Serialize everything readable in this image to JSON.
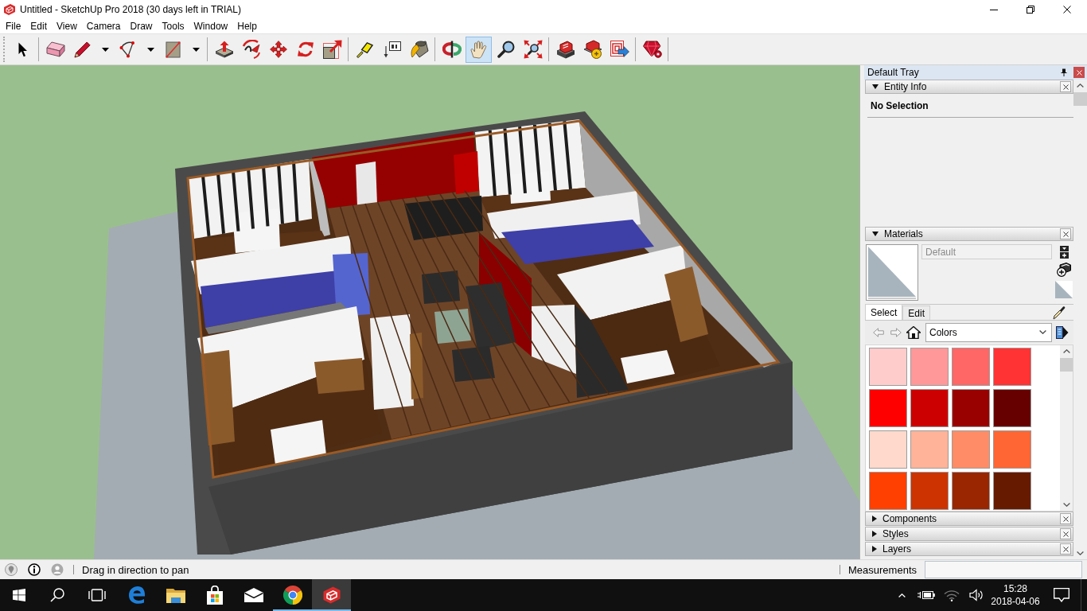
{
  "window": {
    "title": "Untitled - SketchUp Pro 2018 (30 days left in TRIAL)"
  },
  "menu": [
    "File",
    "Edit",
    "View",
    "Camera",
    "Draw",
    "Tools",
    "Window",
    "Help"
  ],
  "toolbar": {
    "groups": [
      {
        "tools": [
          {
            "selected": false,
            "dropdown": false
          }
        ]
      },
      {
        "tools": [
          {
            "selected": false,
            "dropdown": false
          },
          {
            "selected": false,
            "dropdown": true
          },
          {
            "selected": false,
            "dropdown": true
          },
          {
            "selected": false,
            "dropdown": true
          }
        ]
      },
      {
        "tools": [
          {
            "selected": false,
            "dropdown": false
          },
          {
            "selected": false,
            "dropdown": false
          },
          {
            "selected": false,
            "dropdown": false
          },
          {
            "selected": false,
            "dropdown": false
          },
          {
            "selected": false,
            "dropdown": false
          }
        ]
      },
      {
        "tools": [
          {
            "selected": false,
            "dropdown": false
          },
          {
            "selected": false,
            "dropdown": false
          },
          {
            "selected": false,
            "dropdown": false
          }
        ]
      },
      {
        "tools": [
          {
            "selected": false,
            "dropdown": false
          },
          {
            "selected": true,
            "dropdown": false
          },
          {
            "selected": false,
            "dropdown": false
          },
          {
            "selected": false,
            "dropdown": false
          }
        ]
      },
      {
        "tools": [
          {
            "selected": false,
            "dropdown": false
          },
          {
            "selected": false,
            "dropdown": false
          },
          {
            "selected": false,
            "dropdown": false
          }
        ]
      },
      {
        "tools": [
          {
            "selected": false,
            "dropdown": false
          }
        ]
      }
    ]
  },
  "tray": {
    "title": "Default Tray",
    "panels": [
      {
        "kind": "entity_info",
        "title": "Entity Info",
        "expanded": true,
        "text": "No Selection"
      },
      {
        "kind": "materials",
        "title": "Materials",
        "expanded": true,
        "name_field": {
          "value": "Default",
          "disabled": true
        },
        "tabs": [
          {
            "label": "Select",
            "selected": true
          },
          {
            "label": "Edit",
            "selected": false
          }
        ],
        "library": "Colors",
        "swatches": [
          {
            "color": "#ffcccc"
          },
          {
            "color": "#ff9999"
          },
          {
            "color": "#ff6666"
          },
          {
            "color": "#ff3333"
          },
          {
            "color": "#ff0000"
          },
          {
            "color": "#cc0000"
          },
          {
            "color": "#990000"
          },
          {
            "color": "#660000"
          },
          {
            "color": "#ffd9cc"
          },
          {
            "color": "#ffb399"
          },
          {
            "color": "#ff8c66"
          },
          {
            "color": "#ff6633"
          },
          {
            "color": "#ff4000"
          },
          {
            "color": "#cc3300"
          },
          {
            "color": "#992600"
          },
          {
            "color": "#661a00"
          }
        ]
      },
      {
        "kind": "panel",
        "title": "Components",
        "expanded": false
      },
      {
        "kind": "panel",
        "title": "Styles",
        "expanded": false
      },
      {
        "kind": "panel",
        "title": "Layers",
        "expanded": false
      }
    ]
  },
  "status_bar": {
    "hint": "Drag in direction to pan",
    "measurements_label": "Measurements"
  },
  "taskbar": {
    "apps": [
      {
        "running": false,
        "active": false
      },
      {
        "running": false,
        "active": false
      },
      {
        "running": false,
        "active": false
      },
      {
        "running": false,
        "active": false
      },
      {
        "running": true,
        "active": false
      },
      {
        "running": true,
        "active": true
      }
    ],
    "clock": {
      "time": "15:28",
      "date": "2018-04-06"
    }
  }
}
